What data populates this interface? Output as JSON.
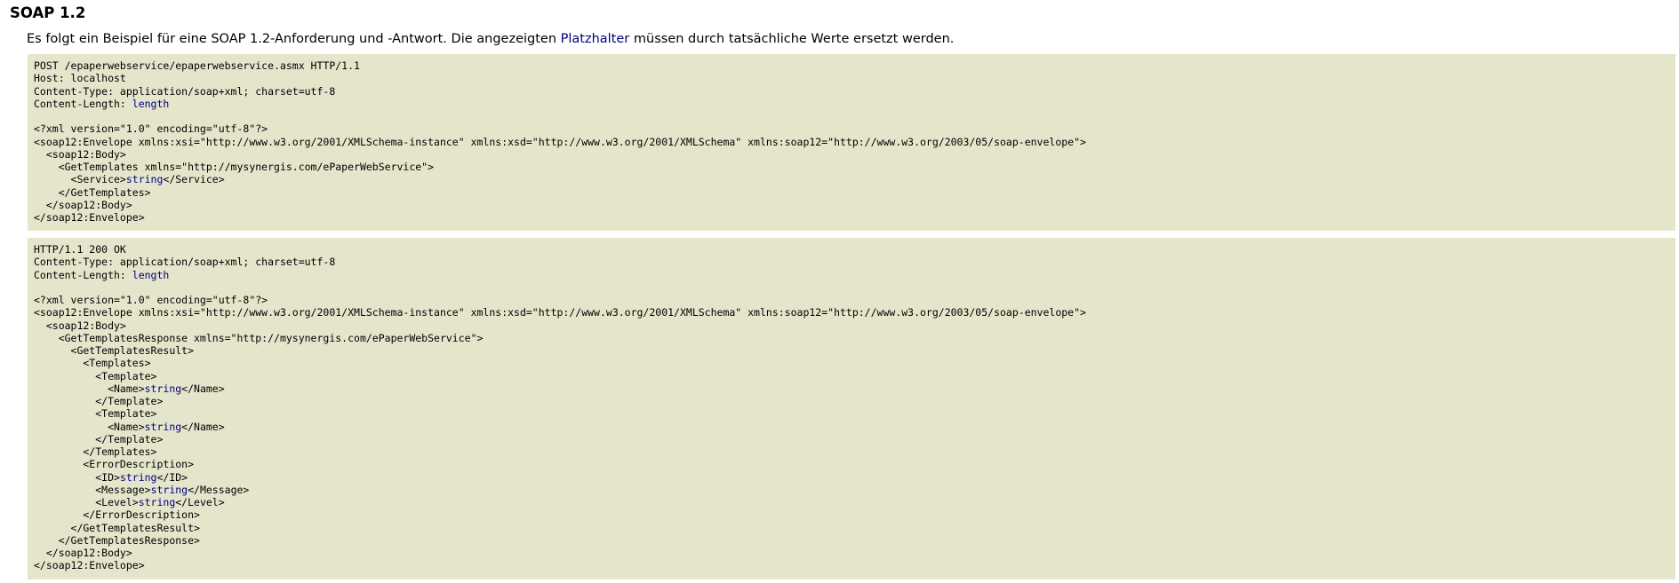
{
  "heading": "SOAP 1.2",
  "intro": {
    "before": "Es folgt ein Beispiel für eine SOAP 1.2-Anforderung und -Antwort. Die angezeigten ",
    "placeholder_word": "Platzhalter",
    "after": " müssen durch tatsächliche Werte ersetzt werden."
  },
  "colors": {
    "code_background": "#e5e5cc",
    "placeholder": "#000080"
  },
  "request_lines": [
    {
      "pre": "POST /epaperwebservice/epaperwebservice.asmx HTTP/1.1"
    },
    {
      "pre": "Host: localhost"
    },
    {
      "pre": "Content-Type: application/soap+xml; charset=utf-8"
    },
    {
      "pre": "Content-Length: ",
      "val": "length"
    },
    {
      "pre": ""
    },
    {
      "pre": "<?xml version=\"1.0\" encoding=\"utf-8\"?>"
    },
    {
      "pre": "<soap12:Envelope xmlns:xsi=\"http://www.w3.org/2001/XMLSchema-instance\" xmlns:xsd=\"http://www.w3.org/2001/XMLSchema\" xmlns:soap12=\"http://www.w3.org/2003/05/soap-envelope\">"
    },
    {
      "pre": "  <soap12:Body>"
    },
    {
      "pre": "    <GetTemplates xmlns=\"http://mysynergis.com/ePaperWebService\">"
    },
    {
      "pre": "      <Service>",
      "val": "string",
      "post": "</Service>"
    },
    {
      "pre": "    </GetTemplates>"
    },
    {
      "pre": "  </soap12:Body>"
    },
    {
      "pre": "</soap12:Envelope>"
    }
  ],
  "response_lines": [
    {
      "pre": "HTTP/1.1 200 OK"
    },
    {
      "pre": "Content-Type: application/soap+xml; charset=utf-8"
    },
    {
      "pre": "Content-Length: ",
      "val": "length"
    },
    {
      "pre": ""
    },
    {
      "pre": "<?xml version=\"1.0\" encoding=\"utf-8\"?>"
    },
    {
      "pre": "<soap12:Envelope xmlns:xsi=\"http://www.w3.org/2001/XMLSchema-instance\" xmlns:xsd=\"http://www.w3.org/2001/XMLSchema\" xmlns:soap12=\"http://www.w3.org/2003/05/soap-envelope\">"
    },
    {
      "pre": "  <soap12:Body>"
    },
    {
      "pre": "    <GetTemplatesResponse xmlns=\"http://mysynergis.com/ePaperWebService\">"
    },
    {
      "pre": "      <GetTemplatesResult>"
    },
    {
      "pre": "        <Templates>"
    },
    {
      "pre": "          <Template>"
    },
    {
      "pre": "            <Name>",
      "val": "string",
      "post": "</Name>"
    },
    {
      "pre": "          </Template>"
    },
    {
      "pre": "          <Template>"
    },
    {
      "pre": "            <Name>",
      "val": "string",
      "post": "</Name>"
    },
    {
      "pre": "          </Template>"
    },
    {
      "pre": "        </Templates>"
    },
    {
      "pre": "        <ErrorDescription>"
    },
    {
      "pre": "          <ID>",
      "val": "string",
      "post": "</ID>"
    },
    {
      "pre": "          <Message>",
      "val": "string",
      "post": "</Message>"
    },
    {
      "pre": "          <Level>",
      "val": "string",
      "post": "</Level>"
    },
    {
      "pre": "        </ErrorDescription>"
    },
    {
      "pre": "      </GetTemplatesResult>"
    },
    {
      "pre": "    </GetTemplatesResponse>"
    },
    {
      "pre": "  </soap12:Body>"
    },
    {
      "pre": "</soap12:Envelope>"
    }
  ]
}
